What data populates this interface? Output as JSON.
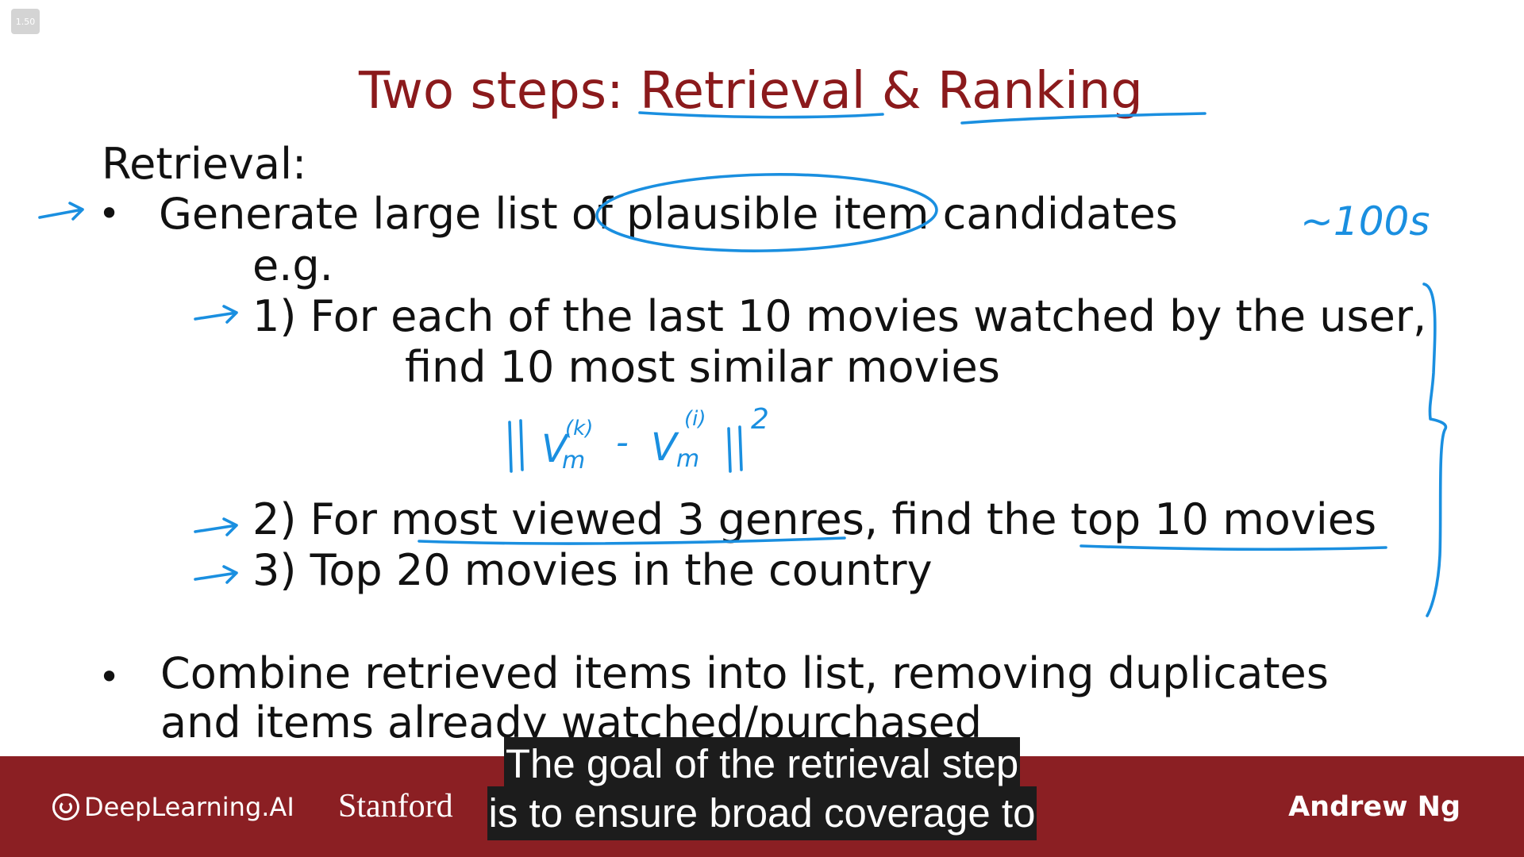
{
  "player": {
    "speed_label": "1.50"
  },
  "slide": {
    "title": "Two steps: Retrieval & Ranking",
    "section_heading": "Retrieval:",
    "bullet_symbol": "•",
    "bullet1": "Generate large list of plausible item candidates",
    "eg": "e.g.",
    "item1_line1": "1) For each of the last 10 movies watched by the user,",
    "item1_line2": "find 10 most similar movies",
    "item2": "2) For most viewed 3 genres, find the top 10 movies",
    "item3": "3) Top 20 movies in the country",
    "bullet2_line1": "Combine retrieved items into list, removing duplicates",
    "bullet2_line2": "and items already watched/purchased"
  },
  "annotations": {
    "count_note": "~100s",
    "formula_v": "V",
    "formula_sub": "m",
    "formula_sup_k": "(k)",
    "formula_sup_i": "(i)",
    "formula_minus": "-",
    "formula_exp": "2",
    "ink_color": "#1a8fe0"
  },
  "footer": {
    "brand": "DeepLearning.AI",
    "institution": "Stanford",
    "presenter": "Andrew Ng",
    "background_color": "#8b1f23"
  },
  "captions": {
    "line1": "The goal of the retrieval step",
    "line2": "is to ensure broad coverage to"
  }
}
